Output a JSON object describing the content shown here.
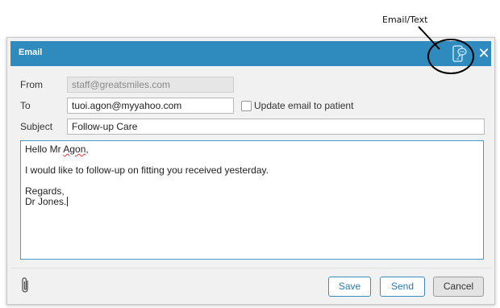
{
  "annotation": {
    "label": "Email/Text"
  },
  "dialog": {
    "title": "Email",
    "icons": {
      "channel": "mobile-message-icon",
      "close": "close-icon",
      "attach": "paperclip-icon"
    },
    "accent_color": "#2f8bbd"
  },
  "form": {
    "from_label": "From",
    "from_value": "staff@greatsmiles.com",
    "to_label": "To",
    "to_value": "tuoi.agon@myyahoo.com",
    "update_checkbox_label": "Update email to patient",
    "update_checked": false,
    "subject_label": "Subject",
    "subject_value": "Follow-up Care"
  },
  "message": {
    "greeting_prefix": "Hello Mr ",
    "greeting_name": "Agon",
    "greeting_suffix": ",",
    "line2": "I would like to follow-up on fitting you received yesterday.",
    "closing": "Regards,",
    "signature": "Dr Jones."
  },
  "buttons": {
    "save": "Save",
    "send": "Send",
    "cancel": "Cancel"
  }
}
